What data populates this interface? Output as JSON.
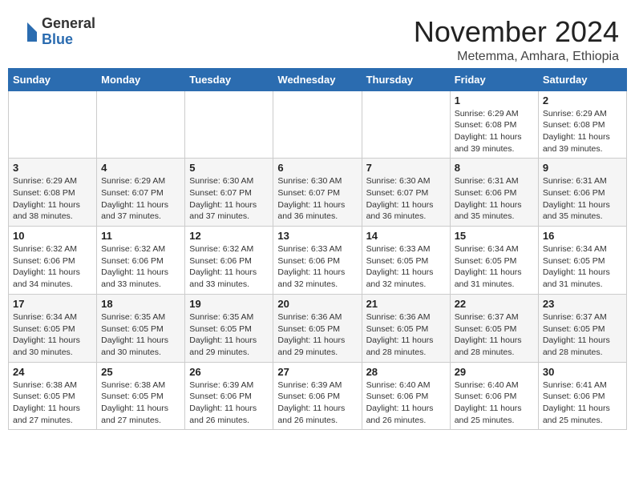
{
  "logo": {
    "general": "General",
    "blue": "Blue"
  },
  "title": "November 2024",
  "location": "Metemma, Amhara, Ethiopia",
  "days_of_week": [
    "Sunday",
    "Monday",
    "Tuesday",
    "Wednesday",
    "Thursday",
    "Friday",
    "Saturday"
  ],
  "weeks": [
    [
      {
        "day": "",
        "info": ""
      },
      {
        "day": "",
        "info": ""
      },
      {
        "day": "",
        "info": ""
      },
      {
        "day": "",
        "info": ""
      },
      {
        "day": "",
        "info": ""
      },
      {
        "day": "1",
        "info": "Sunrise: 6:29 AM\nSunset: 6:08 PM\nDaylight: 11 hours and 39 minutes."
      },
      {
        "day": "2",
        "info": "Sunrise: 6:29 AM\nSunset: 6:08 PM\nDaylight: 11 hours and 39 minutes."
      }
    ],
    [
      {
        "day": "3",
        "info": "Sunrise: 6:29 AM\nSunset: 6:08 PM\nDaylight: 11 hours and 38 minutes."
      },
      {
        "day": "4",
        "info": "Sunrise: 6:29 AM\nSunset: 6:07 PM\nDaylight: 11 hours and 37 minutes."
      },
      {
        "day": "5",
        "info": "Sunrise: 6:30 AM\nSunset: 6:07 PM\nDaylight: 11 hours and 37 minutes."
      },
      {
        "day": "6",
        "info": "Sunrise: 6:30 AM\nSunset: 6:07 PM\nDaylight: 11 hours and 36 minutes."
      },
      {
        "day": "7",
        "info": "Sunrise: 6:30 AM\nSunset: 6:07 PM\nDaylight: 11 hours and 36 minutes."
      },
      {
        "day": "8",
        "info": "Sunrise: 6:31 AM\nSunset: 6:06 PM\nDaylight: 11 hours and 35 minutes."
      },
      {
        "day": "9",
        "info": "Sunrise: 6:31 AM\nSunset: 6:06 PM\nDaylight: 11 hours and 35 minutes."
      }
    ],
    [
      {
        "day": "10",
        "info": "Sunrise: 6:32 AM\nSunset: 6:06 PM\nDaylight: 11 hours and 34 minutes."
      },
      {
        "day": "11",
        "info": "Sunrise: 6:32 AM\nSunset: 6:06 PM\nDaylight: 11 hours and 33 minutes."
      },
      {
        "day": "12",
        "info": "Sunrise: 6:32 AM\nSunset: 6:06 PM\nDaylight: 11 hours and 33 minutes."
      },
      {
        "day": "13",
        "info": "Sunrise: 6:33 AM\nSunset: 6:06 PM\nDaylight: 11 hours and 32 minutes."
      },
      {
        "day": "14",
        "info": "Sunrise: 6:33 AM\nSunset: 6:05 PM\nDaylight: 11 hours and 32 minutes."
      },
      {
        "day": "15",
        "info": "Sunrise: 6:34 AM\nSunset: 6:05 PM\nDaylight: 11 hours and 31 minutes."
      },
      {
        "day": "16",
        "info": "Sunrise: 6:34 AM\nSunset: 6:05 PM\nDaylight: 11 hours and 31 minutes."
      }
    ],
    [
      {
        "day": "17",
        "info": "Sunrise: 6:34 AM\nSunset: 6:05 PM\nDaylight: 11 hours and 30 minutes."
      },
      {
        "day": "18",
        "info": "Sunrise: 6:35 AM\nSunset: 6:05 PM\nDaylight: 11 hours and 30 minutes."
      },
      {
        "day": "19",
        "info": "Sunrise: 6:35 AM\nSunset: 6:05 PM\nDaylight: 11 hours and 29 minutes."
      },
      {
        "day": "20",
        "info": "Sunrise: 6:36 AM\nSunset: 6:05 PM\nDaylight: 11 hours and 29 minutes."
      },
      {
        "day": "21",
        "info": "Sunrise: 6:36 AM\nSunset: 6:05 PM\nDaylight: 11 hours and 28 minutes."
      },
      {
        "day": "22",
        "info": "Sunrise: 6:37 AM\nSunset: 6:05 PM\nDaylight: 11 hours and 28 minutes."
      },
      {
        "day": "23",
        "info": "Sunrise: 6:37 AM\nSunset: 6:05 PM\nDaylight: 11 hours and 28 minutes."
      }
    ],
    [
      {
        "day": "24",
        "info": "Sunrise: 6:38 AM\nSunset: 6:05 PM\nDaylight: 11 hours and 27 minutes."
      },
      {
        "day": "25",
        "info": "Sunrise: 6:38 AM\nSunset: 6:05 PM\nDaylight: 11 hours and 27 minutes."
      },
      {
        "day": "26",
        "info": "Sunrise: 6:39 AM\nSunset: 6:06 PM\nDaylight: 11 hours and 26 minutes."
      },
      {
        "day": "27",
        "info": "Sunrise: 6:39 AM\nSunset: 6:06 PM\nDaylight: 11 hours and 26 minutes."
      },
      {
        "day": "28",
        "info": "Sunrise: 6:40 AM\nSunset: 6:06 PM\nDaylight: 11 hours and 26 minutes."
      },
      {
        "day": "29",
        "info": "Sunrise: 6:40 AM\nSunset: 6:06 PM\nDaylight: 11 hours and 25 minutes."
      },
      {
        "day": "30",
        "info": "Sunrise: 6:41 AM\nSunset: 6:06 PM\nDaylight: 11 hours and 25 minutes."
      }
    ]
  ]
}
